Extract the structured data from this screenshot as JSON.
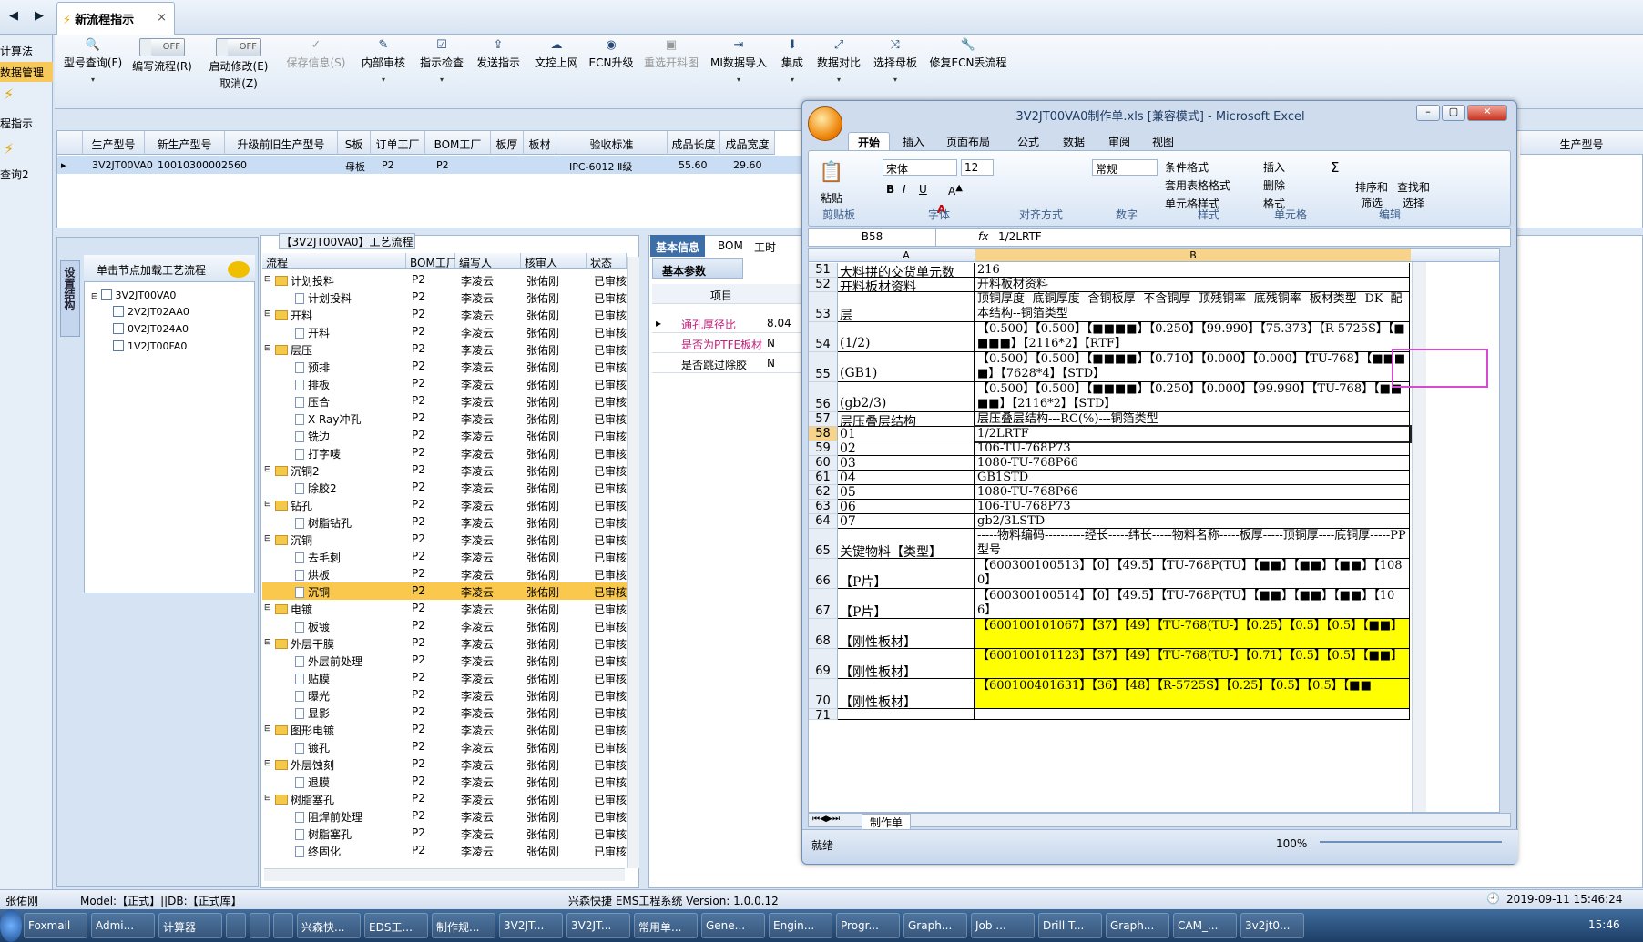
{
  "tabbar": {
    "doc_tab": "新流程指示",
    "close": "×",
    "back": "◀",
    "forward": "▶"
  },
  "leftnav": {
    "items": [
      "计算法",
      "数据管理",
      "程指示",
      "查询2"
    ]
  },
  "toolbar": {
    "buttons": [
      {
        "icon": "search-icon",
        "label": "型号查询(F)"
      },
      {
        "icon": "toggle",
        "label": "编写流程(R)",
        "toggle": "OFF"
      },
      {
        "icon": "toggle",
        "label": "启动修改(E)",
        "toggle": "OFF",
        "sub": "取消(Z)"
      },
      {
        "icon": "check-icon",
        "label": "保存信息(S)"
      },
      {
        "icon": "edit-icon",
        "label": "内部审核"
      },
      {
        "icon": "checklist-icon",
        "label": "指示检查"
      },
      {
        "icon": "send-icon",
        "label": "发送指示"
      },
      {
        "icon": "upload-icon",
        "label": "文控上网"
      },
      {
        "icon": "ecn-icon",
        "label": "ECN升级"
      },
      {
        "icon": "image-icon",
        "label": "重选开料图"
      },
      {
        "icon": "import-icon",
        "label": "MI数据导入"
      },
      {
        "icon": "merge-icon",
        "label": "集成"
      },
      {
        "icon": "compare-icon",
        "label": "数据对比"
      },
      {
        "icon": "shuffle-icon",
        "label": "选择母板"
      },
      {
        "icon": "wrench-icon",
        "label": "修复ECN丢流程"
      }
    ]
  },
  "topgrid": {
    "columns": [
      "生产型号",
      "新生产型号",
      "升级前旧生产型号",
      "S板",
      "订单工厂",
      "BOM工厂",
      "板厚",
      "板材",
      "验收标准",
      "成品长度",
      "成品宽度"
    ],
    "row": [
      "3V2JT00VA0",
      "10010300002560",
      "",
      "母板",
      "P2",
      "P2",
      "",
      "",
      "IPC-6012 Ⅱ级",
      "55.60",
      "29.60"
    ],
    "right_header": "生产型号"
  },
  "tree": {
    "vtab": "设置结构",
    "header": "单击节点加载工艺流程",
    "root": "3V2JT00VA0",
    "children": [
      "2V2JT02AA0",
      "0V2JT024A0",
      "1V2JT00FA0"
    ]
  },
  "process": {
    "title": "【3V2JT00VA0】工艺流程",
    "columns": [
      "流程",
      "BOM工厂",
      "编写人",
      "核审人",
      "状态"
    ],
    "rows": [
      {
        "name": "计划投料",
        "folder": true,
        "bom": "P2",
        "writer": "李凌云",
        "checker": "张佑刚",
        "status": "已审核"
      },
      {
        "name": "计划投料",
        "folder": false,
        "bom": "P2",
        "writer": "李凌云",
        "checker": "张佑刚",
        "status": "已审核"
      },
      {
        "name": "开料",
        "folder": true,
        "bom": "P2",
        "writer": "李凌云",
        "checker": "张佑刚",
        "status": "已审核"
      },
      {
        "name": "开料",
        "folder": false,
        "bom": "P2",
        "writer": "李凌云",
        "checker": "张佑刚",
        "status": "已审核"
      },
      {
        "name": "层压",
        "folder": true,
        "bom": "P2",
        "writer": "李凌云",
        "checker": "张佑刚",
        "status": "已审核"
      },
      {
        "name": "预排",
        "folder": false,
        "bom": "P2",
        "writer": "李凌云",
        "checker": "张佑刚",
        "status": "已审核"
      },
      {
        "name": "排板",
        "folder": false,
        "bom": "P2",
        "writer": "李凌云",
        "checker": "张佑刚",
        "status": "已审核"
      },
      {
        "name": "压合",
        "folder": false,
        "bom": "P2",
        "writer": "李凌云",
        "checker": "张佑刚",
        "status": "已审核"
      },
      {
        "name": "X-Ray冲孔",
        "folder": false,
        "bom": "P2",
        "writer": "李凌云",
        "checker": "张佑刚",
        "status": "已审核"
      },
      {
        "name": "铣边",
        "folder": false,
        "bom": "P2",
        "writer": "李凌云",
        "checker": "张佑刚",
        "status": "已审核"
      },
      {
        "name": "打字唛",
        "folder": false,
        "bom": "P2",
        "writer": "李凌云",
        "checker": "张佑刚",
        "status": "已审核"
      },
      {
        "name": "沉铜2",
        "folder": true,
        "bom": "P2",
        "writer": "李凌云",
        "checker": "张佑刚",
        "status": "已审核"
      },
      {
        "name": "除胶2",
        "folder": false,
        "bom": "P2",
        "writer": "李凌云",
        "checker": "张佑刚",
        "status": "已审核"
      },
      {
        "name": "钻孔",
        "folder": true,
        "bom": "P2",
        "writer": "李凌云",
        "checker": "张佑刚",
        "status": "已审核"
      },
      {
        "name": "树脂钻孔",
        "folder": false,
        "bom": "P2",
        "writer": "李凌云",
        "checker": "张佑刚",
        "status": "已审核"
      },
      {
        "name": "沉铜",
        "folder": true,
        "bom": "P2",
        "writer": "李凌云",
        "checker": "张佑刚",
        "status": "已审核"
      },
      {
        "name": "去毛刺",
        "folder": false,
        "bom": "P2",
        "writer": "李凌云",
        "checker": "张佑刚",
        "status": "已审核"
      },
      {
        "name": "烘板",
        "folder": false,
        "bom": "P2",
        "writer": "李凌云",
        "checker": "张佑刚",
        "status": "已审核"
      },
      {
        "name": "沉铜",
        "folder": false,
        "bom": "P2",
        "writer": "李凌云",
        "checker": "张佑刚",
        "status": "已审核",
        "selected": true
      },
      {
        "name": "电镀",
        "folder": true,
        "bom": "P2",
        "writer": "李凌云",
        "checker": "张佑刚",
        "status": "已审核"
      },
      {
        "name": "板镀",
        "folder": false,
        "bom": "P2",
        "writer": "李凌云",
        "checker": "张佑刚",
        "status": "已审核"
      },
      {
        "name": "外层干膜",
        "folder": true,
        "bom": "P2",
        "writer": "李凌云",
        "checker": "张佑刚",
        "status": "已审核"
      },
      {
        "name": "外层前处理",
        "folder": false,
        "bom": "P2",
        "writer": "李凌云",
        "checker": "张佑刚",
        "status": "已审核"
      },
      {
        "name": "贴膜",
        "folder": false,
        "bom": "P2",
        "writer": "李凌云",
        "checker": "张佑刚",
        "status": "已审核"
      },
      {
        "name": "曝光",
        "folder": false,
        "bom": "P2",
        "writer": "李凌云",
        "checker": "张佑刚",
        "status": "已审核"
      },
      {
        "name": "显影",
        "folder": false,
        "bom": "P2",
        "writer": "李凌云",
        "checker": "张佑刚",
        "status": "已审核"
      },
      {
        "name": "图形电镀",
        "folder": true,
        "bom": "P2",
        "writer": "李凌云",
        "checker": "张佑刚",
        "status": "已审核"
      },
      {
        "name": "镀孔",
        "folder": false,
        "bom": "P2",
        "writer": "李凌云",
        "checker": "张佑刚",
        "status": "已审核"
      },
      {
        "name": "外层蚀刻",
        "folder": true,
        "bom": "P2",
        "writer": "李凌云",
        "checker": "张佑刚",
        "status": "已审核"
      },
      {
        "name": "退膜",
        "folder": false,
        "bom": "P2",
        "writer": "李凌云",
        "checker": "张佑刚",
        "status": "已审核"
      },
      {
        "name": "树脂塞孔",
        "folder": true,
        "bom": "P2",
        "writer": "李凌云",
        "checker": "张佑刚",
        "status": "已审核"
      },
      {
        "name": "阻焊前处理",
        "folder": false,
        "bom": "P2",
        "writer": "李凌云",
        "checker": "张佑刚",
        "status": "已审核"
      },
      {
        "name": "树脂塞孔",
        "folder": false,
        "bom": "P2",
        "writer": "李凌云",
        "checker": "张佑刚",
        "status": "已审核"
      },
      {
        "name": "终固化",
        "folder": false,
        "bom": "P2",
        "writer": "李凌云",
        "checker": "张佑刚",
        "status": "已审核"
      }
    ]
  },
  "info": {
    "tabs": [
      "基本信息",
      "BOM",
      "工时"
    ],
    "group": "基本参数",
    "col": "项目",
    "rows": [
      {
        "label": "通孔厚径比",
        "value": "8.04"
      },
      {
        "label": "是否为PTFE板材",
        "value": "N"
      },
      {
        "label": "是否跳过除胶",
        "value": "N"
      }
    ]
  },
  "excel": {
    "title": "3V2JT00VA0制作单.xls [兼容模式] - Microsoft Excel",
    "tabs": [
      "开始",
      "插入",
      "页面布局",
      "公式",
      "数据",
      "审阅",
      "视图"
    ],
    "font": "宋体",
    "size": "12",
    "numfmt": "常规",
    "groups": [
      "剪贴板",
      "字体",
      "对齐方式",
      "数字",
      "样式",
      "单元格",
      "编辑"
    ],
    "paste": "粘贴",
    "styles": [
      "条件格式",
      "套用表格格式",
      "单元格样式"
    ],
    "cells_btns": [
      "插入",
      "删除",
      "格式"
    ],
    "edit_btns": [
      "排序和筛选",
      "查找和选择"
    ],
    "namebox": "B58",
    "formula": "1/2LRTF",
    "col_a": "A",
    "col_b": "B",
    "rows": [
      {
        "n": "51",
        "a": "大料拼的交货单元数",
        "b": "216",
        "h": 16
      },
      {
        "n": "52",
        "a": "开料板材资料",
        "b": "开料板材资料",
        "h": 16
      },
      {
        "n": "53",
        "a": "层",
        "b": "顶铜厚度--底铜厚度--含铜板厚--不含铜厚--顶残铜率--底残铜率--板材类型--DK--配本结构--铜箔类型",
        "h": 33
      },
      {
        "n": "54",
        "a": "(1/2)",
        "b": "【0.500】【0.500】【■■■■】【0.250】【99.990】【75.373】【R-5725S】【■■■■】【2116*2】【RTF】",
        "h": 33
      },
      {
        "n": "55",
        "a": "(GB1)",
        "b": "【0.500】【0.500】【■■■■】【0.710】【0.000】【0.000】【TU-768】【■■■■】【7628*4】【STD】",
        "h": 33
      },
      {
        "n": "56",
        "a": "(gb2/3)",
        "b": "【0.500】【0.500】【■■■■】【0.250】【0.000】【99.990】【TU-768】【■■■■】【2116*2】【STD】",
        "h": 33
      },
      {
        "n": "57",
        "a": "层压叠层结构",
        "b": "层压叠层结构---RC(%)---铜箔类型",
        "h": 16
      },
      {
        "n": "58",
        "a": "01",
        "b": "1/2LRTF",
        "h": 16,
        "sel": true
      },
      {
        "n": "59",
        "a": "02",
        "b": "106-TU-768P73",
        "h": 16
      },
      {
        "n": "60",
        "a": "03",
        "b": "1080-TU-768P66",
        "h": 16
      },
      {
        "n": "61",
        "a": "04",
        "b": "GB1STD",
        "h": 16
      },
      {
        "n": "62",
        "a": "05",
        "b": "1080-TU-768P66",
        "h": 16
      },
      {
        "n": "63",
        "a": "06",
        "b": "106-TU-768P73",
        "h": 16
      },
      {
        "n": "64",
        "a": "07",
        "b": "gb2/3LSTD",
        "h": 16
      },
      {
        "n": "65",
        "a": "关键物料【类型】",
        "b": "-----物料编码----------经长-----纬长-----物料名称-----板厚-----顶铜厚----底铜厚-----PP型号",
        "h": 33
      },
      {
        "n": "66",
        "a": "【P片】",
        "b": "【600300100513】【0】【49.5】【TU-768P(TU】【■■】【■■】【■■】【1080】",
        "h": 33
      },
      {
        "n": "67",
        "a": "【P片】",
        "b": "【600300100514】【0】【49.5】【TU-768P(TU】【■■】【■■】【■■】【106】",
        "h": 33
      },
      {
        "n": "68",
        "a": "【刚性板材】",
        "b": "【600100101067】【37】【49】【TU-768(TU-】【0.25】【0.5】【0.5】【■■】",
        "h": 33,
        "yellow": true
      },
      {
        "n": "69",
        "a": "【刚性板材】",
        "b": "【600100101123】【37】【49】【TU-768(TU-】【0.71】【0.5】【0.5】【■■】",
        "h": 33,
        "yellow": true
      },
      {
        "n": "70",
        "a": "【刚性板材】",
        "b": "【600100401631】【36】【48】【R-5725S】【0.25】【0.5】【0.5】【■■",
        "h": 33,
        "yellow": true
      },
      {
        "n": "71",
        "a": "",
        "b": "",
        "h": 12
      }
    ],
    "sheet_tab": "制作单",
    "status_left": "就绪",
    "zoom": "100%"
  },
  "statusbar": {
    "user": "张佑刚",
    "model": "Model:【正式】||DB:【正式库】",
    "app": "兴森快捷 EMS工程系统 Version: 1.0.0.12",
    "datetime": "2019-09-11 15:46:24"
  },
  "taskbar": {
    "items": [
      "Foxmail",
      "Admi...",
      "计算器",
      "",
      "",
      "",
      "兴森快...",
      "EDS工...",
      "制作规...",
      "3V2JT...",
      "3V2JT...",
      "常用单...",
      "Gene...",
      "Engin...",
      "Progr...",
      "Graph...",
      "Job ...",
      "Drill T...",
      "Graph...",
      "CAM_...",
      "3v2jt0..."
    ],
    "time": "15:46"
  }
}
